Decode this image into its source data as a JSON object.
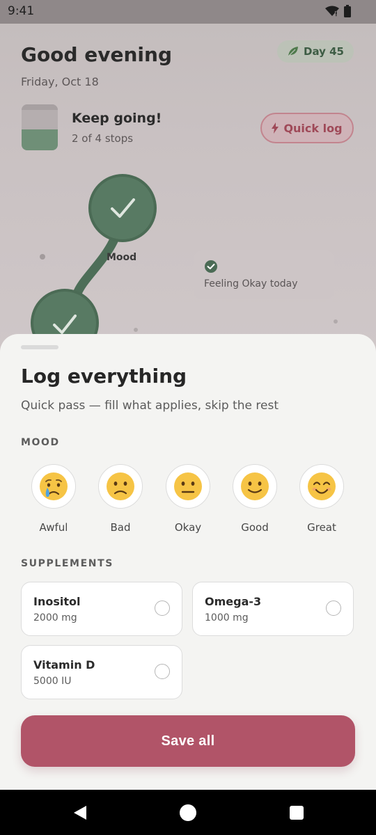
{
  "status_bar": {
    "time": "9:41"
  },
  "header": {
    "greeting": "Good evening",
    "date": "Friday, Oct 18",
    "day_badge": "Day 45"
  },
  "progress": {
    "title": "Keep going!",
    "subtitle": "2 of 4 stops",
    "stops_done": 2,
    "stops_total": 4,
    "quick_log_label": "Quick log"
  },
  "path": {
    "mood_label": "Mood",
    "feeling_text": "Feeling Okay today"
  },
  "sheet": {
    "title": "Log everything",
    "subtitle": "Quick pass — fill what applies, skip the rest",
    "mood_section": "MOOD",
    "moods": [
      {
        "label": "Awful",
        "emoji": "😢"
      },
      {
        "label": "Bad",
        "emoji": "🙁"
      },
      {
        "label": "Okay",
        "emoji": "😐"
      },
      {
        "label": "Good",
        "emoji": "🙂"
      },
      {
        "label": "Great",
        "emoji": "😊"
      }
    ],
    "supplements_section": "SUPPLEMENTS",
    "supplements": [
      {
        "name": "Inositol",
        "dose": "2000 mg",
        "checked": false
      },
      {
        "name": "Omega-3",
        "dose": "1000 mg",
        "checked": false
      },
      {
        "name": "Vitamin D",
        "dose": "5000 IU",
        "checked": false
      }
    ],
    "save_label": "Save all"
  },
  "colors": {
    "accent": "#b15468",
    "sage": "#577562",
    "sheet_bg": "#f4f4f2"
  }
}
